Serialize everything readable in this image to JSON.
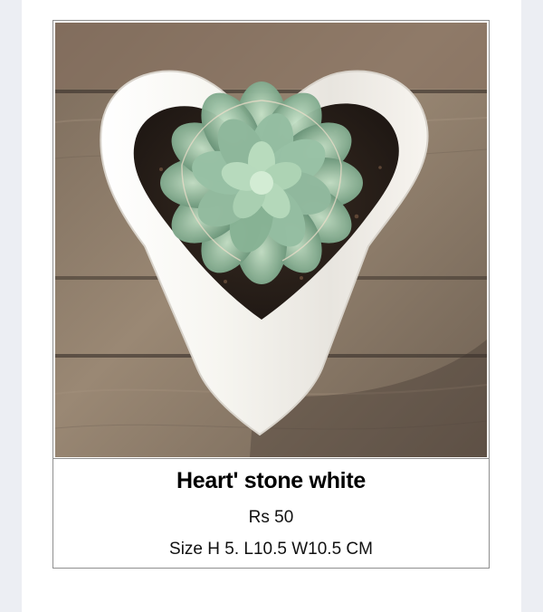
{
  "product": {
    "image_alt": "heart-shaped white pot with green succulent",
    "title": "Heart' stone white",
    "price": "Rs 50",
    "size": "Size H 5. L10.5 W10.5 CM"
  },
  "colors": {
    "page_background": "#eceef3",
    "card_background": "#ffffff",
    "card_border": "#8f8f8f",
    "text": "#000000",
    "pot": "#f3f1ec",
    "soil": "#2f241d",
    "wood": "#8e7d6a",
    "succulent": "#8fb49a"
  },
  "icons": {
    "image": "product-photo"
  }
}
